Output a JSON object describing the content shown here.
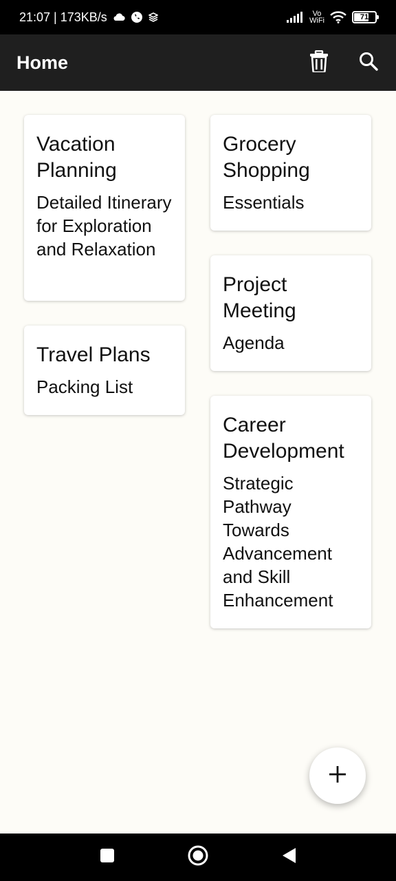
{
  "status_bar": {
    "time_speed": "21:07 | 173KB/s",
    "vowifi_top": "Vo",
    "vowifi_bottom": "WiFi",
    "battery_level": "71",
    "battery_percent": 71
  },
  "app_bar": {
    "title": "Home"
  },
  "notes_left": [
    {
      "title": "Vacation Planning",
      "body": "Detailed Itinerary for Exploration and Relaxation"
    },
    {
      "title": "Travel Plans",
      "body": "Packing List"
    }
  ],
  "notes_right": [
    {
      "title": "Grocery Shopping",
      "body": "Essentials"
    },
    {
      "title": "Project Meeting",
      "body": "Agenda"
    },
    {
      "title": "Career Development",
      "body": "Strategic Pathway Towards Advancement and Skill Enhancement"
    }
  ],
  "icons": {
    "delete": "trash-icon",
    "search": "search-icon",
    "add": "plus-icon",
    "nav_recents": "square-icon",
    "nav_home": "circle-icon",
    "nav_back": "back-triangle-icon"
  },
  "colors": {
    "app_bar_bg": "#1f1f1f",
    "page_bg": "#fdfcf7",
    "card_bg": "#ffffff"
  }
}
